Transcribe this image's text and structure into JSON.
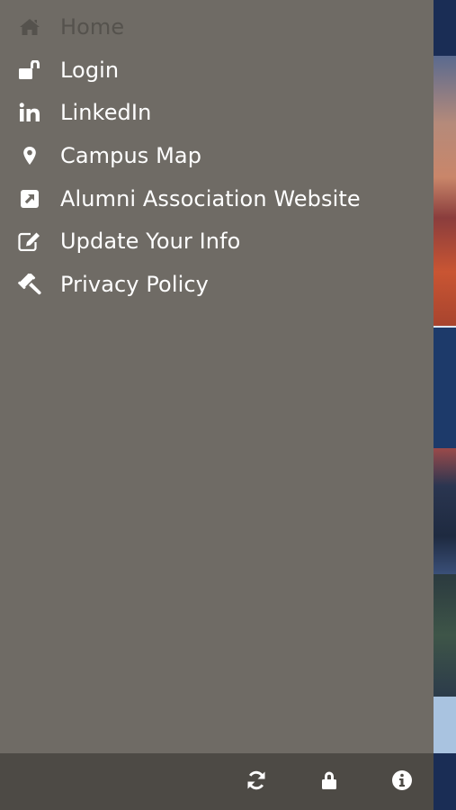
{
  "menu": {
    "items": [
      {
        "label": "Home",
        "icon": "home-icon",
        "active": true
      },
      {
        "label": "Login",
        "icon": "unlock-icon"
      },
      {
        "label": "LinkedIn",
        "icon": "linkedin-icon"
      },
      {
        "label": "Campus Map",
        "icon": "map-marker-icon"
      },
      {
        "label": "Alumni Association Website",
        "icon": "external-link-icon"
      },
      {
        "label": "Update Your Info",
        "icon": "edit-icon"
      },
      {
        "label": "Privacy Policy",
        "icon": "gavel-icon"
      }
    ]
  },
  "toolbar": {
    "buttons": [
      {
        "icon": "refresh-icon"
      },
      {
        "icon": "lock-icon"
      },
      {
        "icon": "info-icon"
      }
    ]
  },
  "colors": {
    "drawer_bg": "#6f6b65",
    "toolbar_bg": "#4d4a45",
    "text": "#ffffff",
    "active_text": "#55524d",
    "app_accent": "#1b2f55"
  }
}
